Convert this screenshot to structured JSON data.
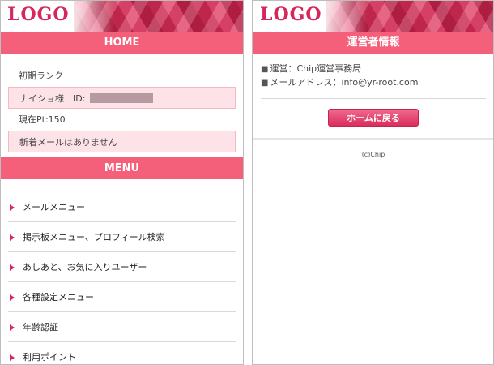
{
  "left": {
    "logo": "LOGO",
    "home_bar": "HOME",
    "info": [
      {
        "text": "初期ランク",
        "highlight": false
      },
      {
        "text": "ナイショ様　ID:",
        "highlight": true,
        "masked": true
      },
      {
        "text": "現在Pt:150",
        "highlight": false
      },
      {
        "text": "新着メールはありません",
        "highlight": true
      }
    ],
    "menu_bar": "MENU",
    "menu": [
      "メールメニュー",
      "掲示板メニュー、プロフィール検索",
      "あしあと、お気に入りユーザー",
      "各種設定メニュー",
      "年齢認証",
      "利用ポイント"
    ]
  },
  "right": {
    "logo": "LOGO",
    "bar": "運営者情報",
    "lines": [
      {
        "bullet": "■",
        "text": "運営：Chip運営事務局"
      },
      {
        "bullet": "■",
        "text": "メールアドレス：info@yr-root.com"
      }
    ],
    "home_button": "ホームに戻る",
    "copyright": "(c)Chip"
  },
  "colors": {
    "accent": "#f4607a",
    "logo": "#d6265a",
    "highlight_row": "#fde3e8"
  },
  "icons": {
    "menu_arrow": "triangle-right-icon"
  }
}
